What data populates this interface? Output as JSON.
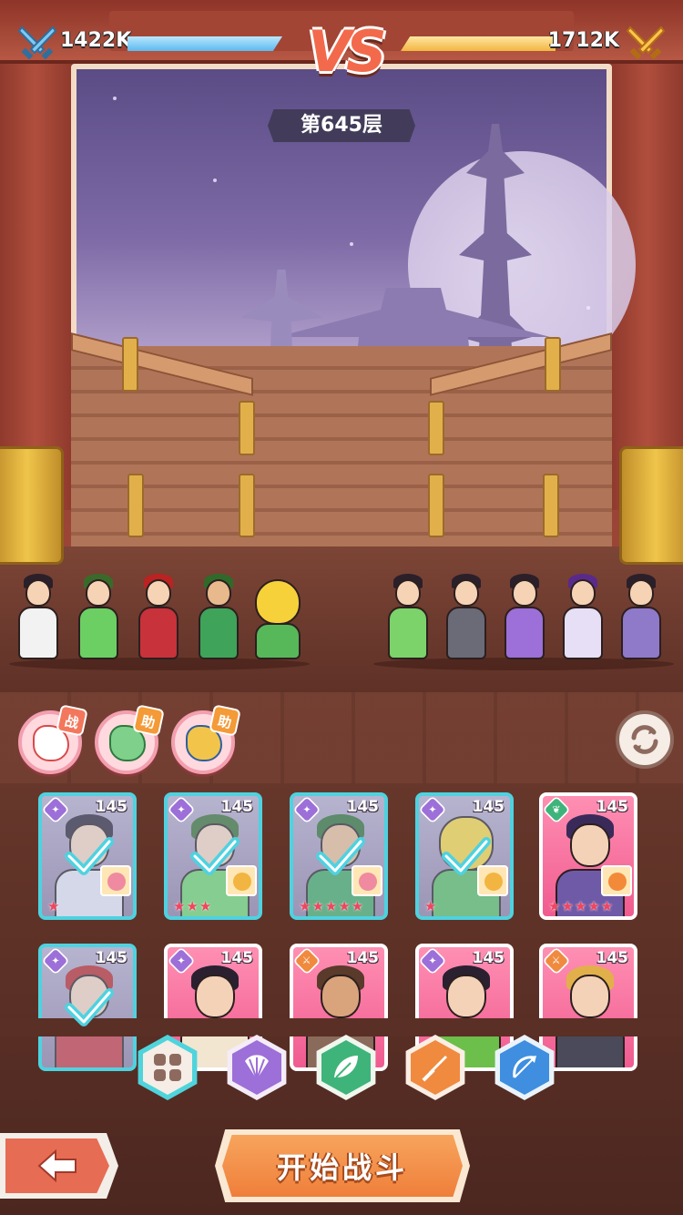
{
  "hud": {
    "left_power": "1422K",
    "right_power": "1712K",
    "left_power_fill": 1.0,
    "right_power_fill": 1.0,
    "vs_text": "VS",
    "floor_label": "第645层"
  },
  "pets": [
    {
      "tag": "战",
      "color": "#f3775c",
      "icon": "white-fox-pet"
    },
    {
      "tag": "助",
      "color": "#f49a37",
      "icon": "green-dragon-pet"
    },
    {
      "tag": "助",
      "color": "#f49a37",
      "icon": "blue-qilin-pet"
    }
  ],
  "refresh_icon": "refresh-icon",
  "cards_row1": [
    {
      "level": "145",
      "selected": true,
      "stars": "★",
      "class": "purple"
    },
    {
      "level": "145",
      "selected": true,
      "stars": "★★★",
      "class": "purple"
    },
    {
      "level": "145",
      "selected": true,
      "stars": "★★★★★",
      "class": "purple"
    },
    {
      "level": "145",
      "selected": true,
      "stars": "★",
      "class": "purple"
    },
    {
      "level": "145",
      "selected": false,
      "stars": "★★★★★",
      "class": "green"
    }
  ],
  "cards_row2": [
    {
      "level": "145",
      "selected": true,
      "class": "purple"
    },
    {
      "level": "145",
      "selected": false,
      "class": "purple"
    },
    {
      "level": "145",
      "selected": false,
      "class": "orange"
    },
    {
      "level": "145",
      "selected": false,
      "class": "purple"
    },
    {
      "level": "145",
      "selected": false,
      "class": "orange"
    }
  ],
  "filters": [
    {
      "name": "all",
      "icon": "grid-icon"
    },
    {
      "name": "strategist",
      "icon": "fan-icon"
    },
    {
      "name": "support",
      "icon": "leaf-icon"
    },
    {
      "name": "warrior",
      "icon": "sword-icon"
    },
    {
      "name": "archer",
      "icon": "bow-icon"
    }
  ],
  "buttons": {
    "back_icon": "arrow-left-icon",
    "start_label": "开始战斗"
  },
  "colors": {
    "accent_blue": "#5cb9ef",
    "accent_orange": "#f3b541",
    "selected_border": "#4ed2e0",
    "card_pink": "#f05b8f",
    "start_button": "#ef7f3a"
  }
}
